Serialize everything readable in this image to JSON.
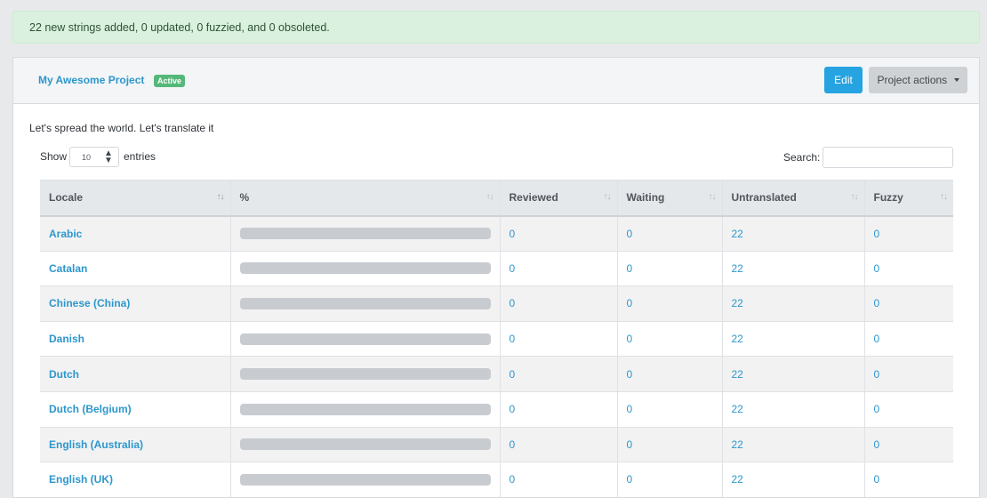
{
  "alert": {
    "message": "22 new strings added, 0 updated, 0 fuzzied, and 0 obsoleted."
  },
  "project": {
    "name": "My Awesome Project",
    "status_badge": "Active",
    "description": "Let's spread the world. Let's translate it"
  },
  "buttons": {
    "edit": "Edit",
    "project_actions": "Project actions"
  },
  "table_controls": {
    "show_label": "Show",
    "entries_value": "10",
    "entries_label": "entries",
    "search_label": "Search:"
  },
  "table": {
    "columns": [
      "Locale",
      "%",
      "Reviewed",
      "Waiting",
      "Untranslated",
      "Fuzzy"
    ],
    "rows": [
      {
        "locale": "Arabic",
        "percent": 0,
        "reviewed": "0",
        "waiting": "0",
        "untranslated": "22",
        "fuzzy": "0"
      },
      {
        "locale": "Catalan",
        "percent": 0,
        "reviewed": "0",
        "waiting": "0",
        "untranslated": "22",
        "fuzzy": "0"
      },
      {
        "locale": "Chinese (China)",
        "percent": 0,
        "reviewed": "0",
        "waiting": "0",
        "untranslated": "22",
        "fuzzy": "0"
      },
      {
        "locale": "Danish",
        "percent": 0,
        "reviewed": "0",
        "waiting": "0",
        "untranslated": "22",
        "fuzzy": "0"
      },
      {
        "locale": "Dutch",
        "percent": 0,
        "reviewed": "0",
        "waiting": "0",
        "untranslated": "22",
        "fuzzy": "0"
      },
      {
        "locale": "Dutch (Belgium)",
        "percent": 0,
        "reviewed": "0",
        "waiting": "0",
        "untranslated": "22",
        "fuzzy": "0"
      },
      {
        "locale": "English (Australia)",
        "percent": 0,
        "reviewed": "0",
        "waiting": "0",
        "untranslated": "22",
        "fuzzy": "0"
      },
      {
        "locale": "English (UK)",
        "percent": 0,
        "reviewed": "0",
        "waiting": "0",
        "untranslated": "22",
        "fuzzy": "0"
      }
    ]
  },
  "icons": {
    "sort": "sort-icon",
    "select_arrow": "select-arrow-icon",
    "dropdown_caret": "chevron-down-icon"
  },
  "colors": {
    "accent": "#26a3e1",
    "link": "#2d97cc",
    "success_badge": "#54b879",
    "alert_background": "#d9f1de",
    "progress_track": "#c8ccd1"
  }
}
